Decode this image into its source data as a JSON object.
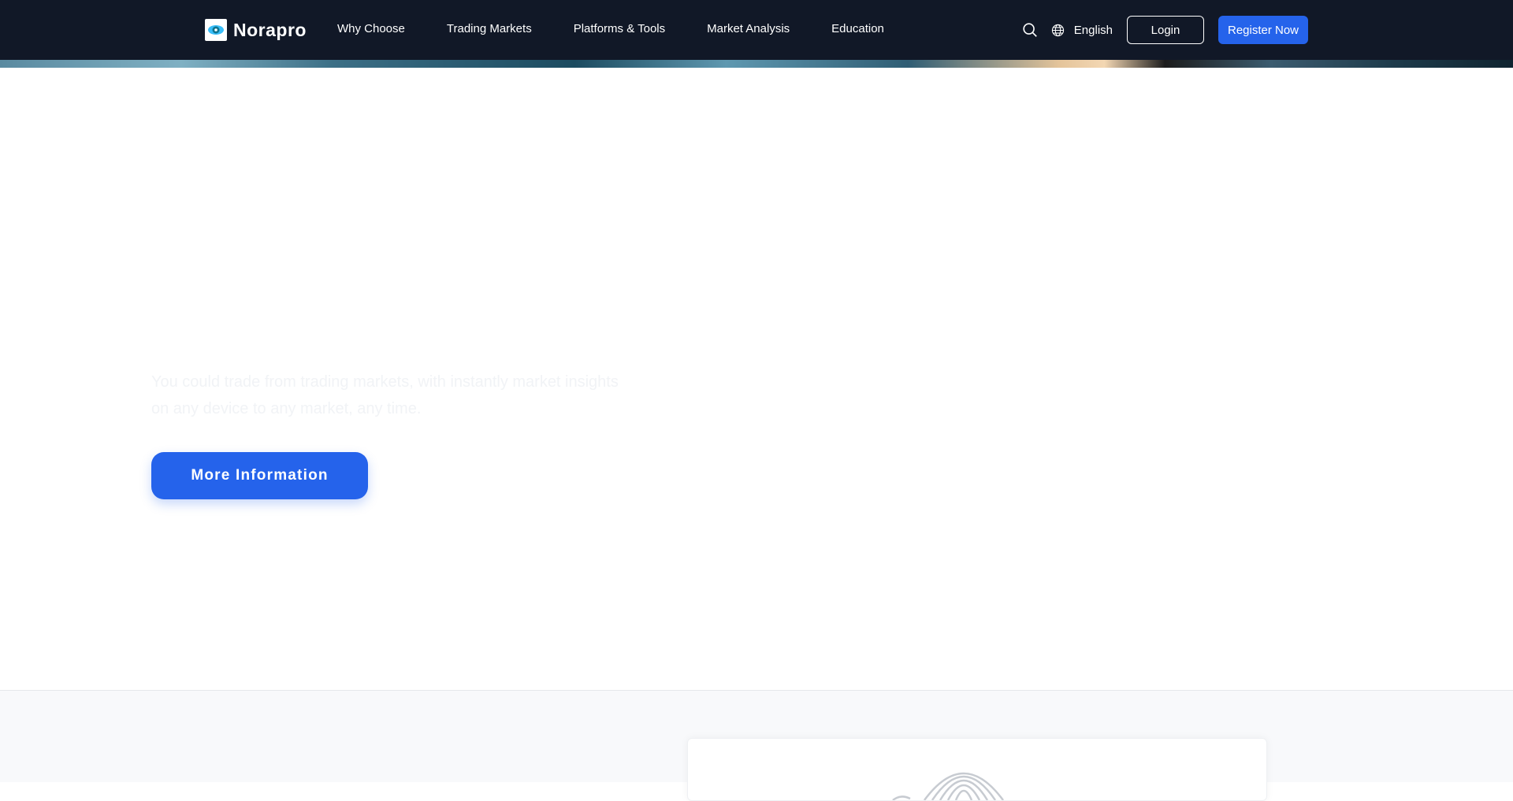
{
  "brand": {
    "name": "Norapro",
    "logo_icon": "eye-logo-icon",
    "accent": "#2563eb",
    "nav_bg": "#111827"
  },
  "nav": {
    "links": [
      {
        "label": "Why Choose"
      },
      {
        "label": "Trading Markets"
      },
      {
        "label": "Platforms & Tools"
      },
      {
        "label": "Market Analysis"
      },
      {
        "label": "Education"
      }
    ]
  },
  "tools": {
    "search_icon": "search-icon",
    "globe_icon": "globe-icon",
    "language": "English",
    "login_label": "Login",
    "register_label": "Register Now"
  },
  "hero": {
    "description": "You could trade from trading markets, with instantly market insights on any device to any market, any time.",
    "more_info_label": "More Information"
  },
  "section2": {
    "card_icon": "fingerprint-icon"
  }
}
